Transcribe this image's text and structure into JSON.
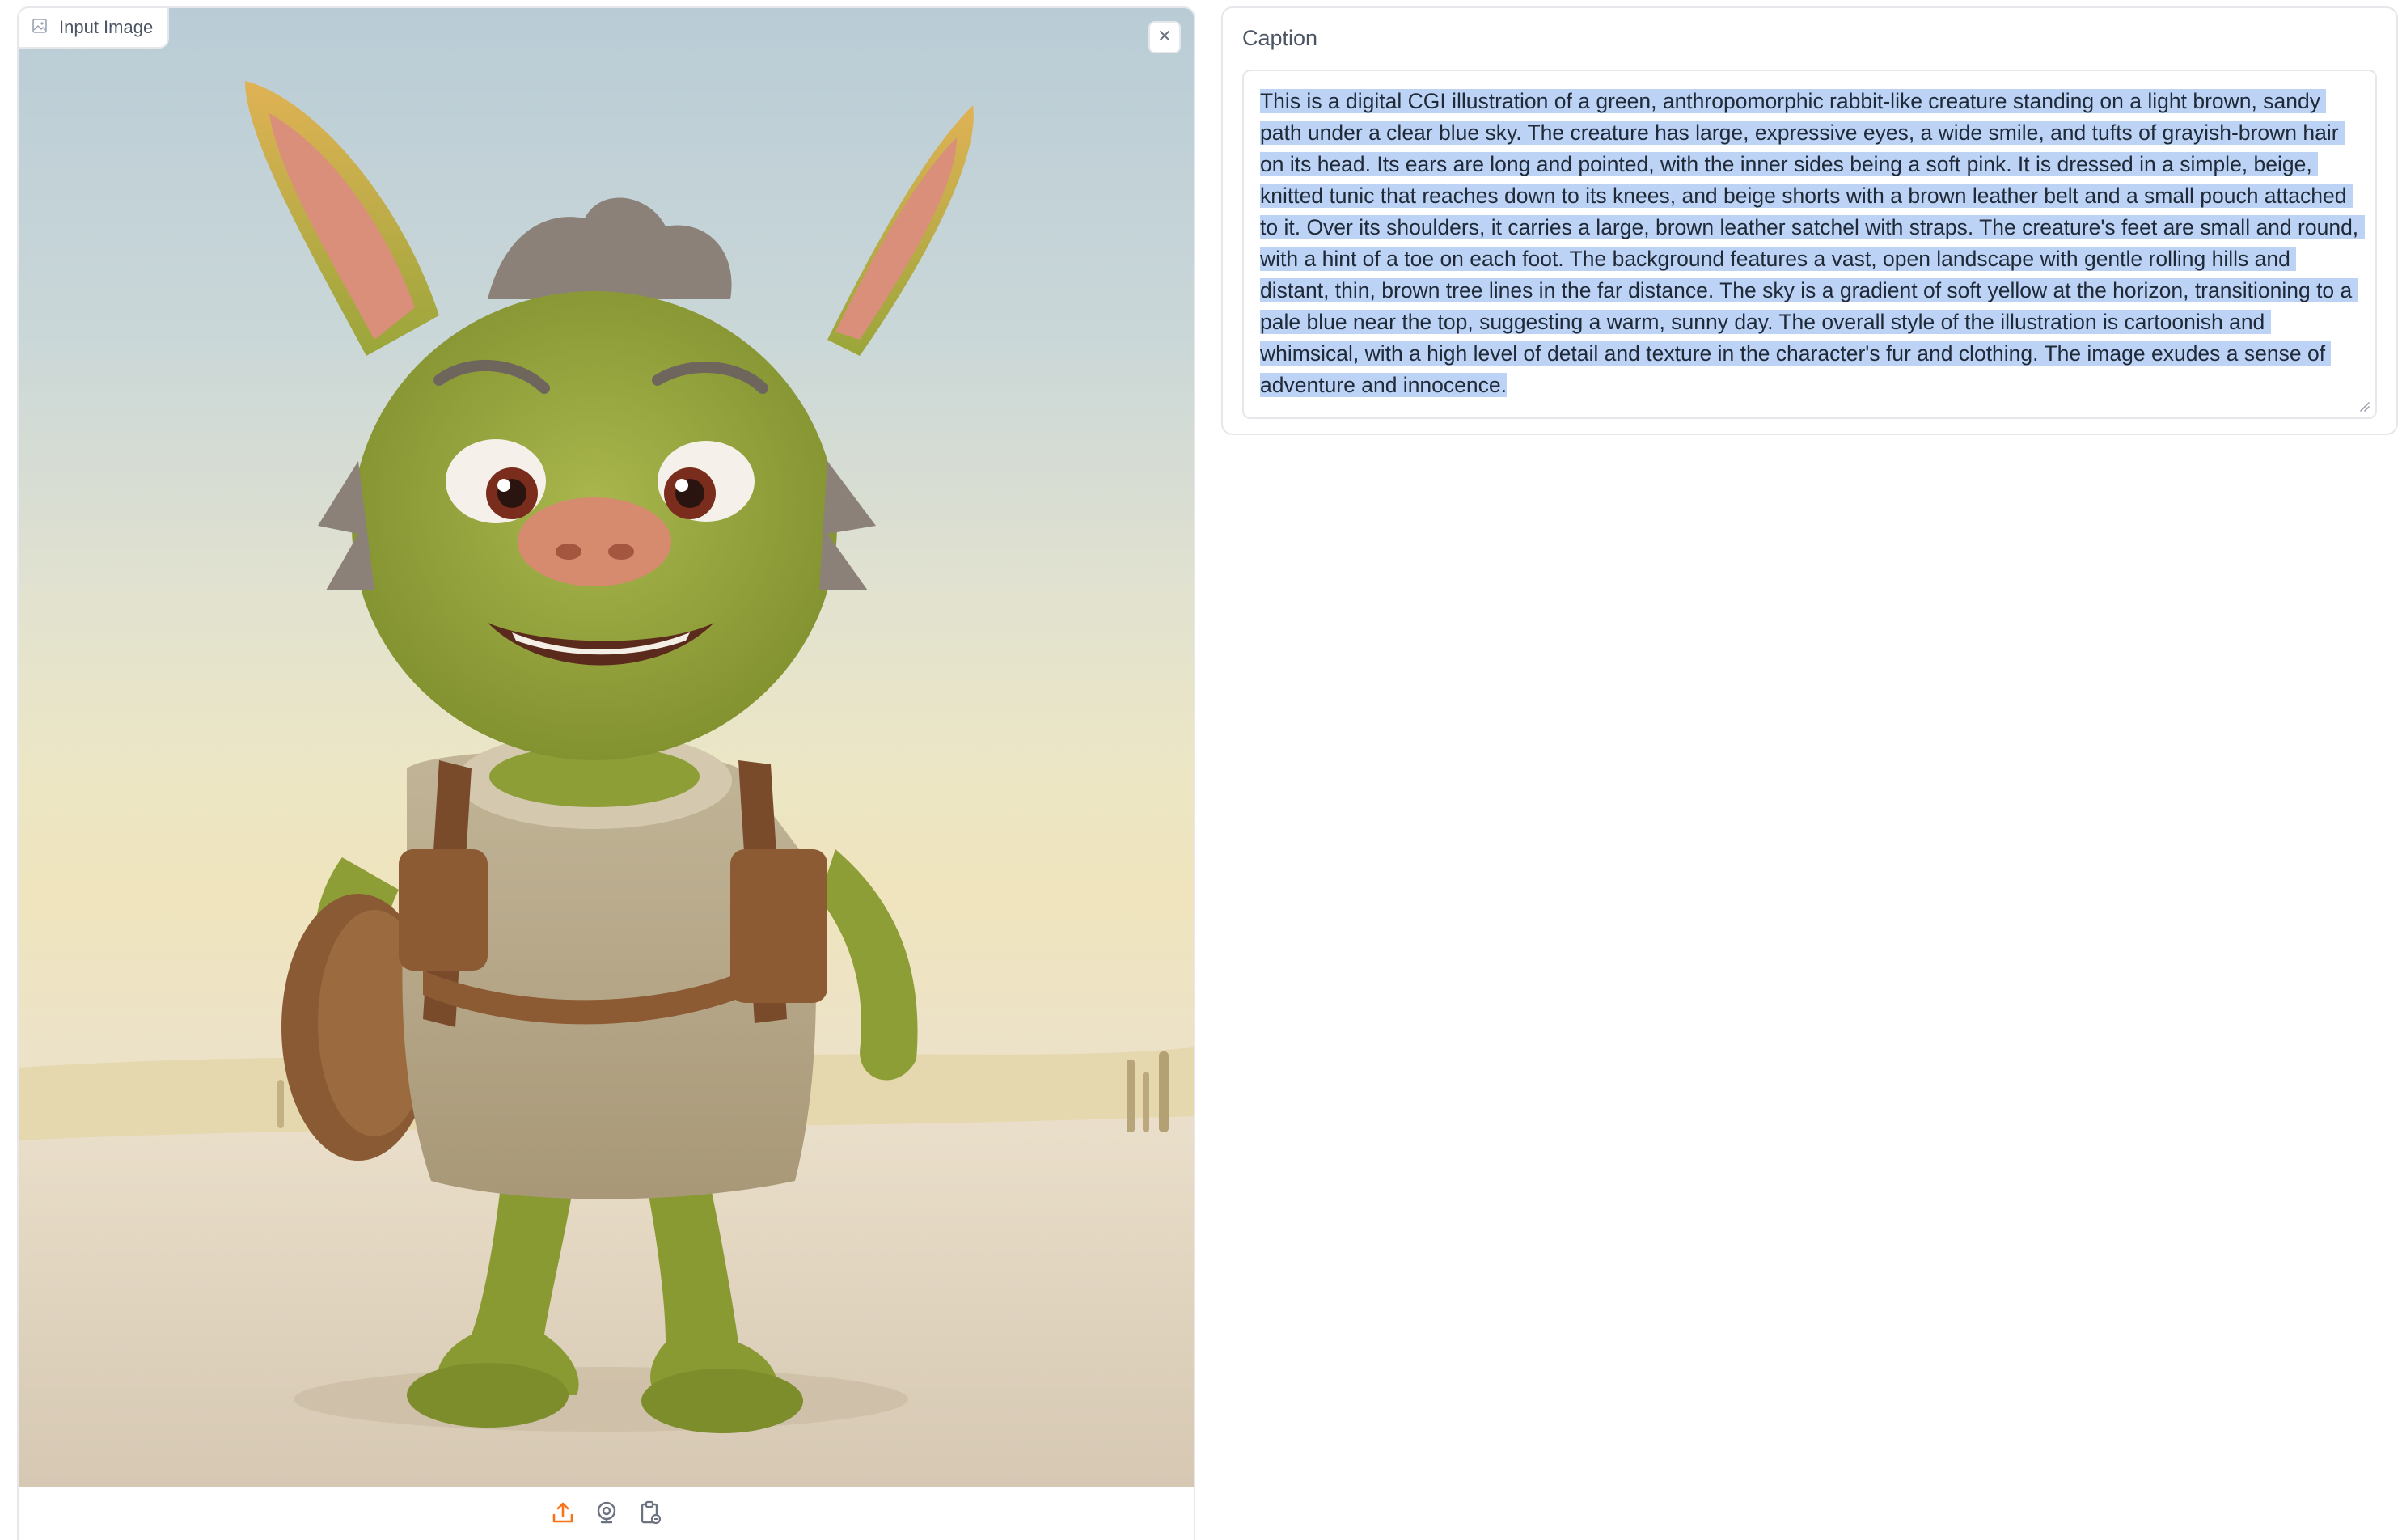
{
  "image_panel": {
    "label": "Input Image",
    "label_icon": "image-icon",
    "close_icon": "close-icon",
    "sources": [
      {
        "name": "upload-icon",
        "color": "#f97316"
      },
      {
        "name": "webcam-icon",
        "color": "#6b7280"
      },
      {
        "name": "clipboard-icon",
        "color": "#6b7280"
      }
    ]
  },
  "caption_panel": {
    "label": "Caption",
    "text": "This is a digital CGI illustration of a green, anthropomorphic rabbit-like creature standing on a light brown, sandy path under a clear blue sky. The creature has large, expressive eyes, a wide smile, and tufts of grayish-brown hair on its head. Its ears are long and pointed, with the inner sides being a soft pink. It is dressed in a simple, beige, knitted tunic that reaches down to its knees, and beige shorts with a brown leather belt and a small pouch attached to it. Over its shoulders, it carries a large, brown leather satchel with straps. The creature's feet are small and round, with a hint of a toe on each foot. The background features a vast, open landscape with gentle rolling hills and distant, thin, brown tree lines in the far distance. The sky is a gradient of soft yellow at the horizon, transitioning to a pale blue near the top, suggesting a warm, sunny day. The overall style of the illustration is cartoonish and whimsical, with a high level of detail and texture in the character's fur and clothing. The image exudes a sense of adventure and innocence.",
    "selection_color": "#bcd3f5"
  },
  "colors": {
    "border": "#e5e7eb",
    "accent": "#f97316",
    "label_text": "#4b5563"
  }
}
